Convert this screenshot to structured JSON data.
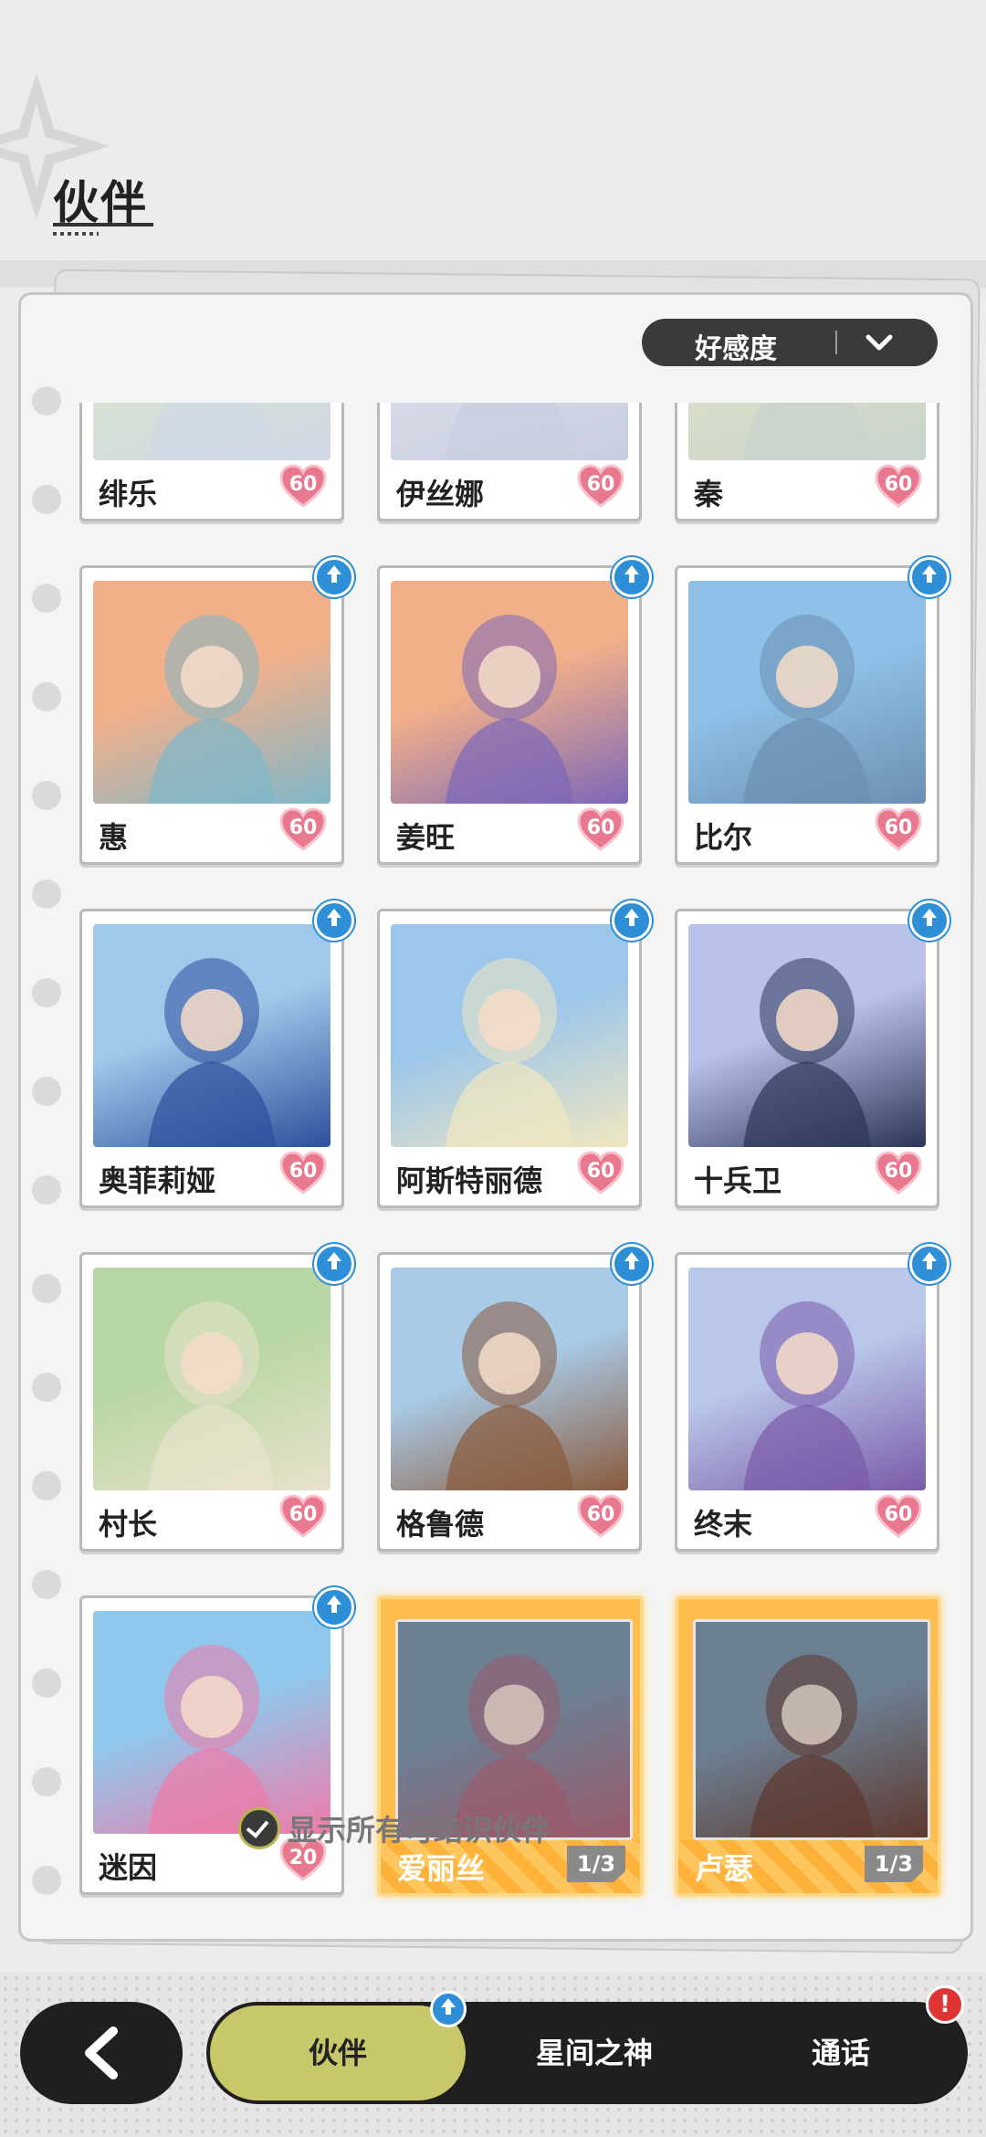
{
  "header": {
    "title": "伙伴"
  },
  "sort": {
    "label": "好感度",
    "icon": "chevron-down-icon"
  },
  "colors": {
    "accent": "#c8c86a",
    "upgrade": "#2f8fd6",
    "gold": "#ffbd4d",
    "alert": "#e03535"
  },
  "partners": [
    {
      "name": "绯乐",
      "affinity": "60",
      "art": [
        "#d9e3d0",
        "#cfd8e6"
      ]
    },
    {
      "name": "伊丝娜",
      "affinity": "60",
      "art": [
        "#d9dde8",
        "#c8cde0"
      ]
    },
    {
      "name": "秦",
      "affinity": "60",
      "art": [
        "#dbe0c9",
        "#c9d3cc"
      ]
    },
    {
      "name": "惠",
      "affinity": "60",
      "art": [
        "#f2b08a",
        "#7fb7c9"
      ],
      "upgrade": true
    },
    {
      "name": "姜旺",
      "affinity": "60",
      "art": [
        "#f2b08a",
        "#7c67b8"
      ],
      "upgrade": true
    },
    {
      "name": "比尔",
      "affinity": "60",
      "art": [
        "#8fc1e8",
        "#6b8fb0"
      ],
      "upgrade": true
    },
    {
      "name": "奥菲莉娅",
      "affinity": "60",
      "art": [
        "#9fc8ea",
        "#2e4f9c"
      ],
      "upgrade": true
    },
    {
      "name": "阿斯特丽德",
      "affinity": "60",
      "art": [
        "#9cc6ea",
        "#f1e7c0"
      ],
      "upgrade": true
    },
    {
      "name": "十兵卫",
      "affinity": "60",
      "art": [
        "#b8c2ea",
        "#2c3558"
      ],
      "upgrade": true
    },
    {
      "name": "村长",
      "affinity": "60",
      "art": [
        "#b9d7a4",
        "#e8e2cc"
      ],
      "upgrade": true
    },
    {
      "name": "格鲁德",
      "affinity": "60",
      "art": [
        "#a9cbe8",
        "#8a5a3c"
      ],
      "upgrade": true
    },
    {
      "name": "终末",
      "affinity": "60",
      "art": [
        "#b9c8ea",
        "#7a5aa8"
      ],
      "upgrade": true
    },
    {
      "name": "迷因",
      "affinity": "20",
      "art": [
        "#8fc8ec",
        "#f07aa8"
      ],
      "upgrade": true
    },
    {
      "name": "爱丽丝",
      "progress": "1/3",
      "art": [
        "#6f8fb0",
        "#c75c7a"
      ],
      "locked": true
    },
    {
      "name": "卢瑟",
      "progress": "1/3",
      "art": [
        "#6f8fb0",
        "#7a3a2a"
      ],
      "locked": true
    }
  ],
  "footer": {
    "show_all_label": "显示所有可结识伙伴"
  },
  "nav": {
    "back_icon": "back-arrow-icon",
    "tabs": [
      {
        "label": "伙伴",
        "active": true,
        "badge": "upgrade"
      },
      {
        "label": "星间之神"
      },
      {
        "label": "通话",
        "badge": "alert"
      }
    ],
    "alert_symbol": "!"
  }
}
